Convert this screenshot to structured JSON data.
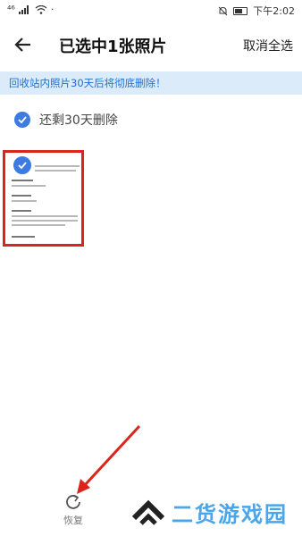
{
  "status_bar": {
    "signal_label": "⁴⁶",
    "time": "下午2:02"
  },
  "header": {
    "title": "已选中1张照片",
    "cancel_all": "取消全选"
  },
  "notice": {
    "text": "回收站内照片30天后将彻底删除！"
  },
  "group": {
    "label": "还剩30天删除"
  },
  "toolbar": {
    "restore_label": "恢复"
  },
  "watermark": {
    "text": "二货游戏园"
  },
  "colors": {
    "accent": "#3d7be3",
    "notice_bg": "#dcebf9",
    "notice_text": "#1f6fd0",
    "highlight_red": "#d9261c"
  },
  "icons": [
    "back-arrow-icon",
    "check-icon",
    "restore-icon",
    "wifi-icon",
    "battery-icon",
    "mute-icon",
    "signal-icon"
  ]
}
